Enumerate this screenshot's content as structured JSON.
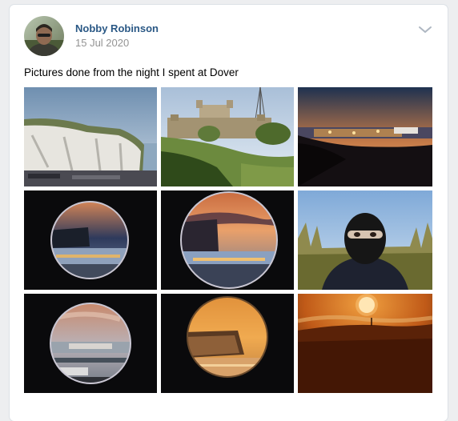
{
  "post": {
    "author": "Nobby Robinson",
    "date": "15 Jul 2020",
    "text": "Pictures done from the night I spent at Dover"
  },
  "icons": {
    "menu": "chevron-down-icon",
    "avatar": "user-avatar"
  },
  "photos": [
    {
      "subject": "white-cliffs-day"
    },
    {
      "subject": "dover-castle"
    },
    {
      "subject": "harbour-night-lights"
    },
    {
      "subject": "telescope-cliffs-dusk"
    },
    {
      "subject": "telescope-cliffs-sunset"
    },
    {
      "subject": "masked-person-portrait"
    },
    {
      "subject": "telescope-ferry-sunset"
    },
    {
      "subject": "telescope-orange-cliff"
    },
    {
      "subject": "orange-sun-over-cliff"
    }
  ],
  "colors": {
    "link": "#2a5885",
    "muted": "#939393",
    "background": "#edeef0"
  }
}
